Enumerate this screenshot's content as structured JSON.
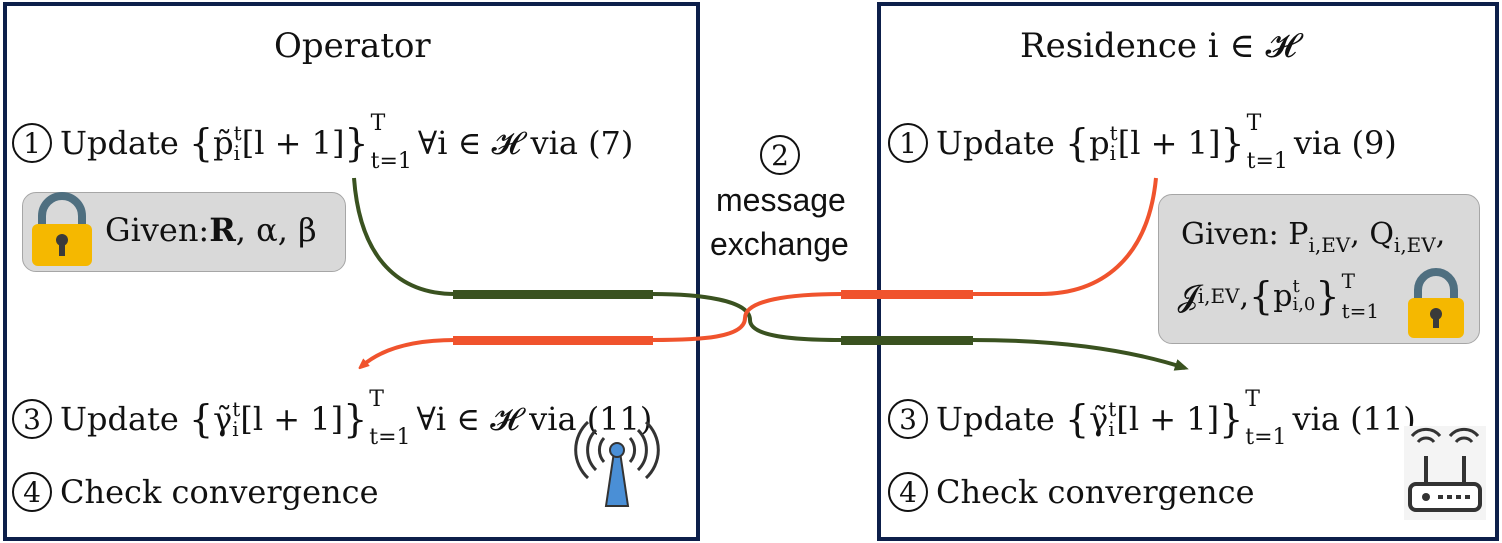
{
  "operator": {
    "title": "Operator",
    "step1": {
      "num": "1",
      "word": "Update",
      "var": "p̃",
      "sub": "i",
      "sup": "t",
      "arg": "[l + 1]",
      "range_top": "T",
      "range_bot": "t=1",
      "tail": "∀i ∈ 𝓗 via (7)"
    },
    "given": {
      "label": "Given:",
      "bold": "R",
      "rest": ", α, β"
    },
    "step3": {
      "num": "3",
      "word": "Update",
      "var": "γ̃",
      "sub": "i",
      "sup": "t",
      "arg": "[l + 1]",
      "range_top": "T",
      "range_bot": "t=1",
      "tail": "∀i ∈ 𝓗 via (11)"
    },
    "step4": {
      "num": "4",
      "text": "Check convergence"
    }
  },
  "middle": {
    "num": "2",
    "line1": "message",
    "line2": "exchange"
  },
  "residence": {
    "title": "Residence i ∈ 𝓗",
    "step1": {
      "num": "1",
      "word": "Update",
      "var": "p",
      "sub": "i",
      "sup": "t",
      "arg": "[l + 1]",
      "range_top": "T",
      "range_bot": "t=1",
      "tail": "via (9)"
    },
    "given": {
      "label": "Given:",
      "p": "P",
      "p_sub": "i,EV",
      "q": "Q",
      "q_sub": "i,EV",
      "j": "𝓙",
      "j_sub": "i,EV",
      "p0": "p",
      "p0_sub": "i,0",
      "p0_sup": "t",
      "range_top": "T",
      "range_bot": "t=1"
    },
    "step3": {
      "num": "3",
      "word": "Update",
      "var": "γ̃",
      "sub": "i",
      "sup": "t",
      "arg": "[l + 1]",
      "range_top": "T",
      "range_bot": "t=1",
      "tail": "via (11)"
    },
    "step4": {
      "num": "4",
      "text": "Check convergence"
    }
  },
  "colors": {
    "border": "#0d1f4a",
    "green": "#3a5220",
    "orange": "#f0532d",
    "lock": "#f5b800",
    "lock_shackle": "#4f6f80"
  },
  "icons": [
    "lock-icon",
    "antenna-icon",
    "router-icon"
  ]
}
